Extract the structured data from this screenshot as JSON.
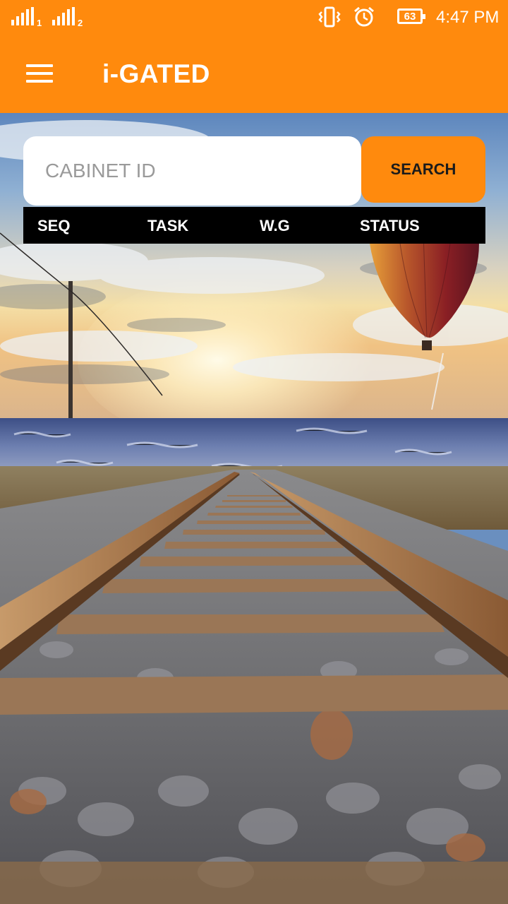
{
  "status_bar": {
    "sim1_label": "1",
    "sim2_label": "2",
    "battery_level": "63",
    "time": "4:47 PM",
    "icons": [
      "signal-sim1-icon",
      "signal-sim2-icon",
      "vibrate-icon",
      "alarm-icon",
      "battery-icon"
    ]
  },
  "app_bar": {
    "title": "i-GATED",
    "menu_icon": "hamburger-menu-icon"
  },
  "search": {
    "placeholder": "CABINET ID",
    "value": "",
    "button_label": "SEARCH"
  },
  "table": {
    "columns": [
      "SEQ",
      "TASK",
      "W.G",
      "STATUS"
    ],
    "rows": []
  },
  "colors": {
    "primary": "#ff8a0d",
    "header_bg": "#000000",
    "input_bg": "#ffffff"
  }
}
